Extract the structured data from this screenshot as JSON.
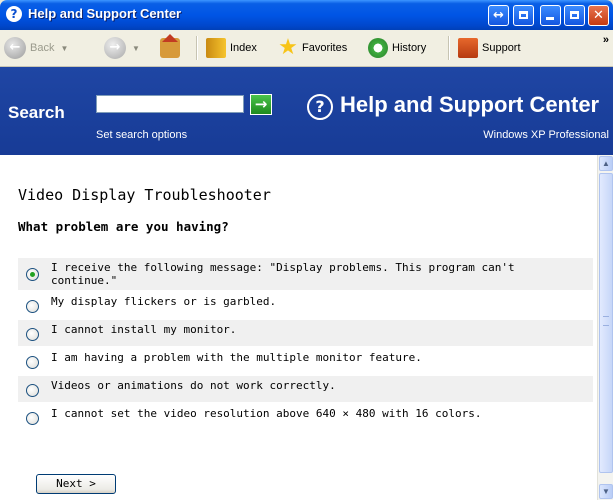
{
  "window": {
    "title": "Help and Support Center"
  },
  "toolbar": {
    "back_label": "Back",
    "index_label": "Index",
    "favorites_label": "Favorites",
    "history_label": "History",
    "support_label": "Support",
    "more_chevron": "»"
  },
  "header": {
    "search_label": "Search",
    "search_value": "",
    "go_glyph": "→",
    "search_options": "Set search options",
    "title": "Help and Support Center",
    "subtitle": "Windows XP Professional",
    "help_glyph": "?"
  },
  "content": {
    "title": "Video Display Troubleshooter",
    "question": "What problem are you having?",
    "options": [
      {
        "label": "I receive the following message: \"Display problems. This program can't continue.\"",
        "selected": true
      },
      {
        "label": "My display flickers or is garbled.",
        "selected": false
      },
      {
        "label": "I cannot install my monitor.",
        "selected": false
      },
      {
        "label": "I am having a problem with the multiple monitor feature.",
        "selected": false
      },
      {
        "label": "Videos or animations do not work correctly.",
        "selected": false
      },
      {
        "label": "I cannot set the video resolution above 640 × 480 with 16 colors.",
        "selected": false
      }
    ],
    "next_label": "Next >"
  },
  "colors": {
    "titlebar": "#0055e5",
    "header_band": "#1f46a4",
    "selected_radio": "#21a121"
  }
}
